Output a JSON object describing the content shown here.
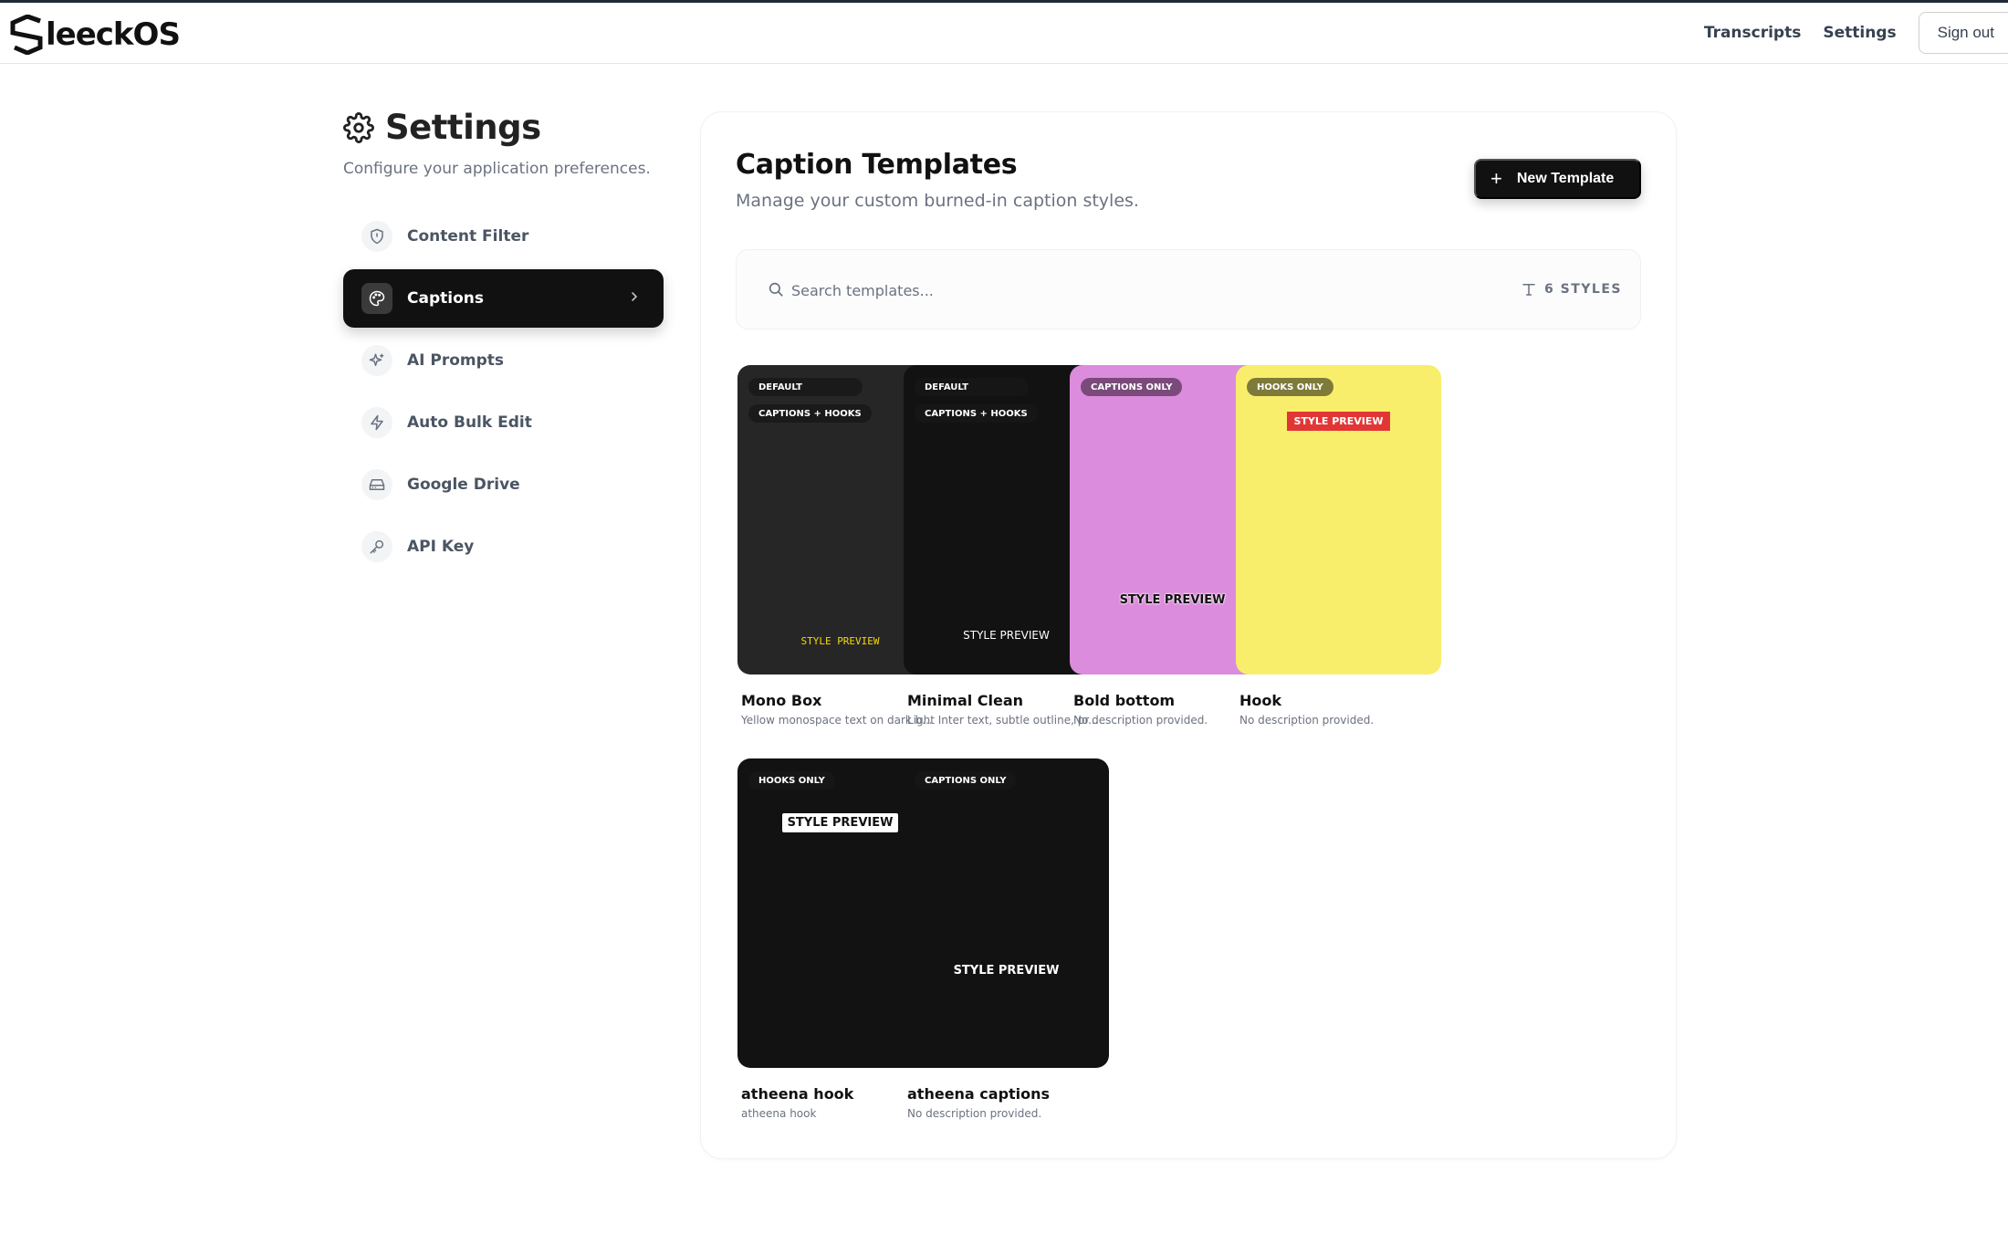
{
  "app": {
    "name": "leeckOS"
  },
  "nav": {
    "transcripts": "Transcripts",
    "settings": "Settings",
    "sign_out": "Sign out"
  },
  "settings": {
    "title": "Settings",
    "subtitle": "Configure your application preferences.",
    "menu": [
      {
        "label": "Content Filter",
        "icon": "shield-icon"
      },
      {
        "label": "Captions",
        "icon": "palette-icon",
        "active": true
      },
      {
        "label": "AI Prompts",
        "icon": "sparkles-icon"
      },
      {
        "label": "Auto Bulk Edit",
        "icon": "lightning-icon"
      },
      {
        "label": "Google Drive",
        "icon": "drive-icon"
      },
      {
        "label": "API Key",
        "icon": "key-icon"
      }
    ]
  },
  "main": {
    "title": "Caption Templates",
    "subtitle": "Manage your custom burned-in caption styles.",
    "new_template": "New Template",
    "search_placeholder": "Search templates...",
    "styles_count": "6 STYLES",
    "templates": [
      {
        "name": "Mono Box",
        "description": "Yellow monospace text on dark b...",
        "badges": [
          "DEFAULT",
          "CAPTIONS + HOOKS"
        ],
        "preview": "STYLE PREVIEW",
        "bg": "#262626",
        "preview_color": "#f5d90a"
      },
      {
        "name": "Minimal Clean",
        "description": "Light Inter text, subtle outline, pr...",
        "badges": [
          "DEFAULT",
          "CAPTIONS + HOOKS"
        ],
        "preview": "STYLE PREVIEW",
        "bg": "#121212",
        "preview_color": "#ffffff"
      },
      {
        "name": "Bold bottom",
        "description": "No description provided.",
        "badges": [
          "CAPTIONS ONLY"
        ],
        "preview": "STYLE PREVIEW",
        "bg": "#dc8cdc",
        "preview_color": "#111111"
      },
      {
        "name": "Hook",
        "description": "No description provided.",
        "badges": [
          "HOOKS ONLY"
        ],
        "preview": "STYLE PREVIEW",
        "bg": "#f8ee6c",
        "preview_color": "#ffffff",
        "preview_bg": "#e23636"
      },
      {
        "name": "atheena hook",
        "description": "atheena hook",
        "badges": [
          "HOOKS ONLY"
        ],
        "preview": "STYLE PREVIEW",
        "bg": "#121212",
        "preview_color": "#111111",
        "preview_bg": "#ffffff"
      },
      {
        "name": "atheena captions",
        "description": "No description provided.",
        "badges": [
          "CAPTIONS ONLY"
        ],
        "preview": "STYLE PREVIEW",
        "bg": "#121212",
        "preview_color": "#ffffff"
      }
    ]
  }
}
